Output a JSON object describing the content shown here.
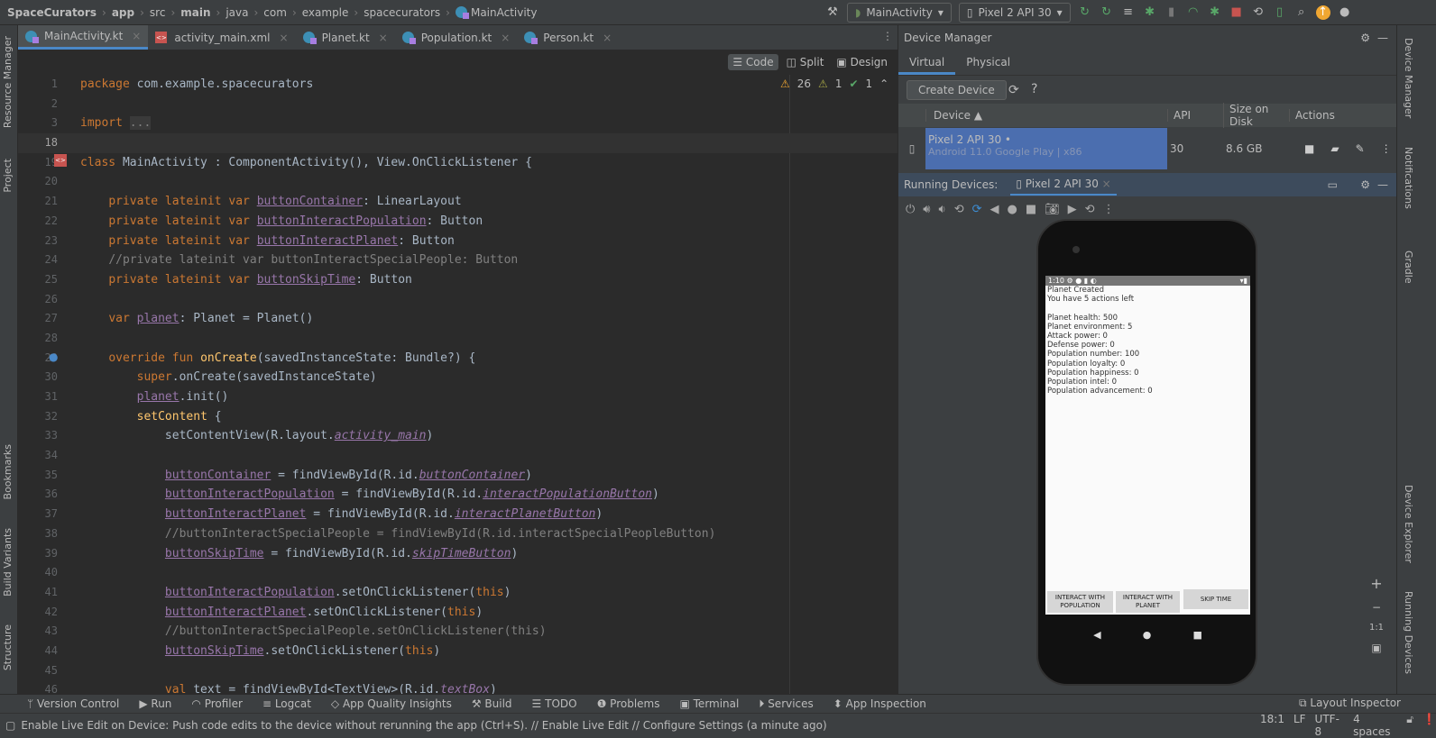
{
  "breadcrumb": [
    "SpaceCurators",
    "app",
    "src",
    "main",
    "java",
    "com",
    "example",
    "spacecurators",
    "MainActivity"
  ],
  "toolbar": {
    "run_config": "MainActivity",
    "device": "Pixel 2 API 30"
  },
  "left_stripe": [
    "Resource Manager",
    "Project",
    "Bookmarks",
    "Build Variants",
    "Structure"
  ],
  "right_stripe": [
    "Device Manager",
    "Notifications",
    "Gradle",
    "Device Explorer",
    "Running Devices"
  ],
  "editor_tabs": [
    {
      "label": "MainActivity.kt",
      "type": "kotlin"
    },
    {
      "label": "activity_main.xml",
      "type": "xml"
    },
    {
      "label": "Planet.kt",
      "type": "kotlin"
    },
    {
      "label": "Population.kt",
      "type": "kotlin"
    },
    {
      "label": "Person.kt",
      "type": "kotlin"
    }
  ],
  "editor_modes": [
    "Code",
    "Split",
    "Design"
  ],
  "inspections": {
    "warnings": "26",
    "weak": "1",
    "ok": "1"
  },
  "code": [
    {
      "n": "1",
      "s": [
        [
          "k",
          "package "
        ],
        [
          "p",
          "com.example.spacecurators"
        ]
      ]
    },
    {
      "n": "2",
      "s": []
    },
    {
      "n": "3",
      "s": [
        [
          "k",
          "import "
        ],
        [
          "fo",
          "..."
        ]
      ]
    },
    {
      "n": "18",
      "s": [],
      "current": true
    },
    {
      "n": "19",
      "s": [
        [
          "k",
          "class "
        ],
        [
          "p",
          "MainActivity : ComponentActivity(), View.OnClickListener {"
        ]
      ]
    },
    {
      "n": "20",
      "s": []
    },
    {
      "n": "21",
      "s": [
        [
          "p",
          "    "
        ],
        [
          "k",
          "private lateinit var "
        ],
        [
          "f",
          "buttonContainer"
        ],
        [
          "p",
          ": LinearLayout"
        ]
      ]
    },
    {
      "n": "22",
      "s": [
        [
          "p",
          "    "
        ],
        [
          "k",
          "private lateinit var "
        ],
        [
          "f",
          "buttonInteractPopulation"
        ],
        [
          "p",
          ": Button"
        ]
      ]
    },
    {
      "n": "23",
      "s": [
        [
          "p",
          "    "
        ],
        [
          "k",
          "private lateinit var "
        ],
        [
          "f",
          "buttonInteractPlanet"
        ],
        [
          "p",
          ": Button"
        ]
      ]
    },
    {
      "n": "24",
      "s": [
        [
          "p",
          "    "
        ],
        [
          "c",
          "//private lateinit var buttonInteractSpecialPeople: Button"
        ]
      ]
    },
    {
      "n": "25",
      "s": [
        [
          "p",
          "    "
        ],
        [
          "k",
          "private lateinit var "
        ],
        [
          "f",
          "buttonSkipTime"
        ],
        [
          "p",
          ": Button"
        ]
      ]
    },
    {
      "n": "26",
      "s": []
    },
    {
      "n": "27",
      "s": [
        [
          "p",
          "    "
        ],
        [
          "k",
          "var "
        ],
        [
          "f",
          "planet"
        ],
        [
          "p",
          ": Planet = Planet()"
        ]
      ]
    },
    {
      "n": "28",
      "s": []
    },
    {
      "n": "29",
      "s": [
        [
          "p",
          "    "
        ],
        [
          "k",
          "override fun "
        ],
        [
          "fn",
          "onCreate"
        ],
        [
          "p",
          "(savedInstanceState: Bundle?) {"
        ]
      ]
    },
    {
      "n": "30",
      "s": [
        [
          "p",
          "        "
        ],
        [
          "k",
          "super"
        ],
        [
          "p",
          ".onCreate(savedInstanceState)"
        ]
      ]
    },
    {
      "n": "31",
      "s": [
        [
          "p",
          "        "
        ],
        [
          "f",
          "planet"
        ],
        [
          "p",
          ".init()"
        ]
      ]
    },
    {
      "n": "32",
      "s": [
        [
          "p",
          "        "
        ],
        [
          "fn",
          "setContent"
        ],
        [
          "p",
          " {"
        ]
      ]
    },
    {
      "n": "33",
      "s": [
        [
          "p",
          "            setContentView(R.layout."
        ],
        [
          "i",
          "activity_main"
        ],
        [
          "p",
          ")"
        ]
      ]
    },
    {
      "n": "34",
      "s": []
    },
    {
      "n": "35",
      "s": [
        [
          "p",
          "            "
        ],
        [
          "f",
          "buttonContainer"
        ],
        [
          "p",
          " = findViewById(R.id."
        ],
        [
          "i",
          "buttonContainer"
        ],
        [
          "p",
          ")"
        ]
      ]
    },
    {
      "n": "36",
      "s": [
        [
          "p",
          "            "
        ],
        [
          "f",
          "buttonInteractPopulation"
        ],
        [
          "p",
          " = findViewById(R.id."
        ],
        [
          "i",
          "interactPopulationButton"
        ],
        [
          "p",
          ")"
        ]
      ]
    },
    {
      "n": "37",
      "s": [
        [
          "p",
          "            "
        ],
        [
          "f",
          "buttonInteractPlanet"
        ],
        [
          "p",
          " = findViewById(R.id."
        ],
        [
          "i",
          "interactPlanetButton"
        ],
        [
          "p",
          ")"
        ]
      ]
    },
    {
      "n": "38",
      "s": [
        [
          "p",
          "            "
        ],
        [
          "c",
          "//buttonInteractSpecialPeople = findViewById(R.id.interactSpecialPeopleButton)"
        ]
      ]
    },
    {
      "n": "39",
      "s": [
        [
          "p",
          "            "
        ],
        [
          "f",
          "buttonSkipTime"
        ],
        [
          "p",
          " = findViewById(R.id."
        ],
        [
          "i",
          "skipTimeButton"
        ],
        [
          "p",
          ")"
        ]
      ]
    },
    {
      "n": "40",
      "s": []
    },
    {
      "n": "41",
      "s": [
        [
          "p",
          "            "
        ],
        [
          "f",
          "buttonInteractPopulation"
        ],
        [
          "p",
          ".setOnClickListener("
        ],
        [
          "k",
          "this"
        ],
        [
          "p",
          ")"
        ]
      ]
    },
    {
      "n": "42",
      "s": [
        [
          "p",
          "            "
        ],
        [
          "f",
          "buttonInteractPlanet"
        ],
        [
          "p",
          ".setOnClickListener("
        ],
        [
          "k",
          "this"
        ],
        [
          "p",
          ")"
        ]
      ]
    },
    {
      "n": "43",
      "s": [
        [
          "p",
          "            "
        ],
        [
          "c",
          "//buttonInteractSpecialPeople.setOnClickListener(this)"
        ]
      ]
    },
    {
      "n": "44",
      "s": [
        [
          "p",
          "            "
        ],
        [
          "f",
          "buttonSkipTime"
        ],
        [
          "p",
          ".setOnClickListener("
        ],
        [
          "k",
          "this"
        ],
        [
          "p",
          ")"
        ]
      ]
    },
    {
      "n": "45",
      "s": []
    },
    {
      "n": "46",
      "s": [
        [
          "p",
          "            "
        ],
        [
          "k",
          "val "
        ],
        [
          "p",
          "text = findViewById<TextView>(R.id."
        ],
        [
          "i",
          "textBox"
        ],
        [
          "p",
          ")"
        ]
      ]
    }
  ],
  "device_manager": {
    "title": "Device Manager",
    "tabs": [
      "Virtual",
      "Physical"
    ],
    "create_label": "Create Device",
    "columns": [
      "Device",
      "API",
      "Size on Disk",
      "Actions"
    ],
    "rows": [
      {
        "name": "Pixel 2 API 30",
        "subtitle": "Android 11.0 Google Play | x86",
        "api": "30",
        "size": "8.6 GB"
      }
    ]
  },
  "running_devices": {
    "label": "Running Devices:",
    "tab": "Pixel 2 API 30"
  },
  "phone": {
    "time": "1:10",
    "lines": [
      "Planet Created",
      "You have 5 actions left",
      "",
      "Planet health: 500",
      "Planet environment: 5",
      "Attack power: 0",
      "Defense power: 0",
      "Population number: 100",
      "Population loyalty: 0",
      "Population happiness: 0",
      "Population intel: 0",
      "Population advancement: 0"
    ],
    "buttons": [
      "INTERACT WITH POPULATION",
      "INTERACT WITH PLANET",
      "SKIP TIME"
    ]
  },
  "zoom_controls": {
    "plus": "+",
    "minus": "−",
    "one": "1:1"
  },
  "bottom_tools": [
    "Version Control",
    "Run",
    "Profiler",
    "Logcat",
    "App Quality Insights",
    "Build",
    "TODO",
    "Problems",
    "Terminal",
    "Services",
    "App Inspection"
  ],
  "layout_inspector": "Layout Inspector",
  "status": {
    "message": "Enable Live Edit on Device: Push code edits to the device without rerunning the app (Ctrl+S). // Enable Live Edit // Configure Settings (a minute ago)",
    "position": "18:1",
    "line_sep": "LF",
    "encoding": "UTF-8",
    "indent": "4 spaces"
  }
}
